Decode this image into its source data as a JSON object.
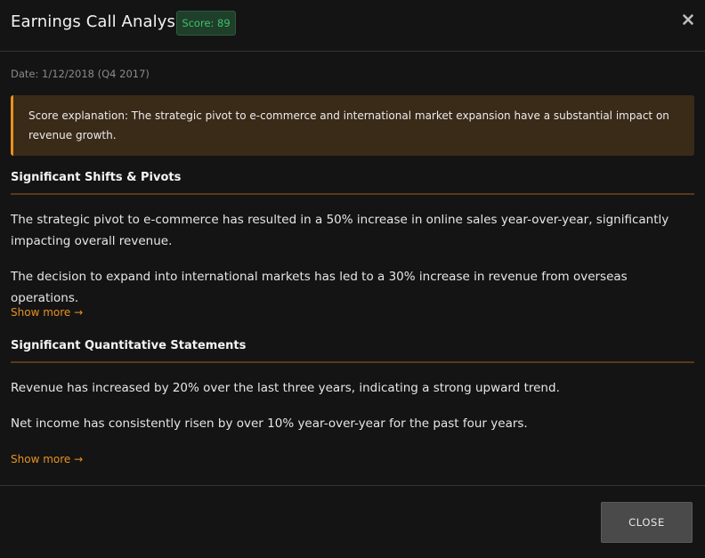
{
  "header": {
    "title": "Earnings Call Analysis",
    "score_badge": "Score: 89",
    "close_icon": "close-x-icon"
  },
  "meta": {
    "date": "Date: 1/12/2018 (Q4 2017)"
  },
  "explanation": {
    "text": "Score explanation: The strategic pivot to e-commerce and international market expansion have a substantial impact on revenue growth."
  },
  "sections": [
    {
      "title": "Significant Shifts & Pivots",
      "paragraphs": [
        "The strategic pivot to e-commerce has resulted in a 50% increase in online sales year-over-year, significantly impacting overall revenue.",
        "The decision to expand into international markets has led to a 30% increase in revenue from overseas operations."
      ],
      "show_more": "Show more →"
    },
    {
      "title": "Significant Quantitative Statements",
      "paragraphs": [
        "Revenue has increased by 20% over the last three years, indicating a strong upward trend.",
        "Net income has consistently risen by over 10% year-over-year for the past four years."
      ],
      "show_more": "Show more →"
    }
  ],
  "footer": {
    "close_label": "CLOSE"
  },
  "colors": {
    "background": "#141414",
    "accent": "#e8921e",
    "score_green": "#3fc06a",
    "explanation_bg": "#3a2a18"
  }
}
